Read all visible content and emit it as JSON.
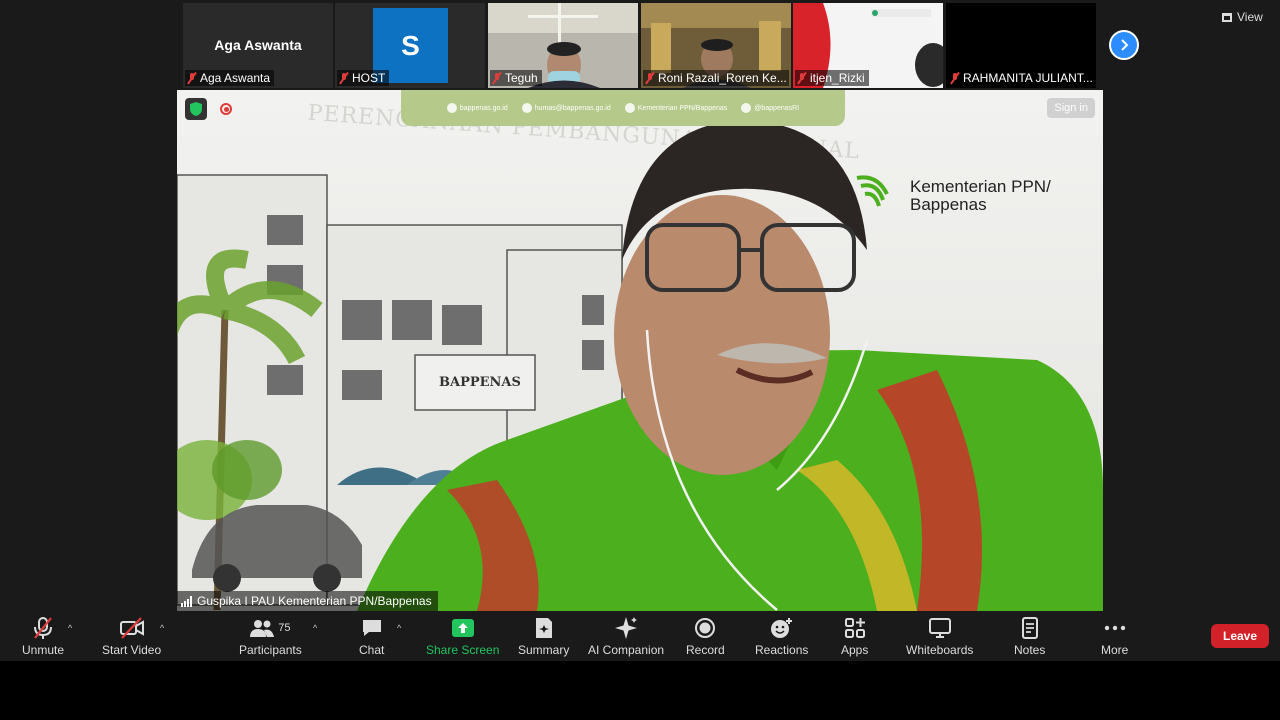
{
  "participants_strip": [
    {
      "name": "Aga Aswanta",
      "center_name": "Aga Aswanta",
      "type": "name"
    },
    {
      "name": "HOST",
      "avatar_letter": "S",
      "type": "avatar"
    },
    {
      "name": "Teguh",
      "type": "video"
    },
    {
      "name": "Roni Razali_Roren Ke...",
      "type": "video"
    },
    {
      "name": "itjen_Rizki",
      "type": "video"
    },
    {
      "name": "RAHMANITA JULIANT...",
      "type": "video"
    }
  ],
  "view_label": "View",
  "main_video": {
    "sign_in": "Sign in",
    "ministry_line1": "Kementerian PPN/",
    "ministry_line2": "Bappenas",
    "building_sign": "BAPPENAS",
    "banner_text": "PERENCANAAN PEMBANGUNAN NASIONAL",
    "top_links": [
      "bappenas.go.id",
      "humas@bappenas.go.id",
      "Kementerian PPN/Bappenas",
      "@bappenasRI"
    ],
    "speaker_name": "Guspika I PAU Kementerian PPN/Bappenas"
  },
  "toolbar": {
    "unmute": "Unmute",
    "start_video": "Start Video",
    "participants": "Participants",
    "participants_count": "75",
    "chat": "Chat",
    "share_screen": "Share Screen",
    "summary": "Summary",
    "ai_companion": "AI Companion",
    "record": "Record",
    "reactions": "Reactions",
    "apps": "Apps",
    "whiteboards": "Whiteboards",
    "notes": "Notes",
    "more": "More",
    "leave": "Leave"
  },
  "colors": {
    "accent_blue": "#2d8cff",
    "share_green": "#22c55e",
    "leave_red": "#d3212a",
    "avatar_blue": "#0e72c3",
    "shirt_green": "#4caf1e"
  }
}
